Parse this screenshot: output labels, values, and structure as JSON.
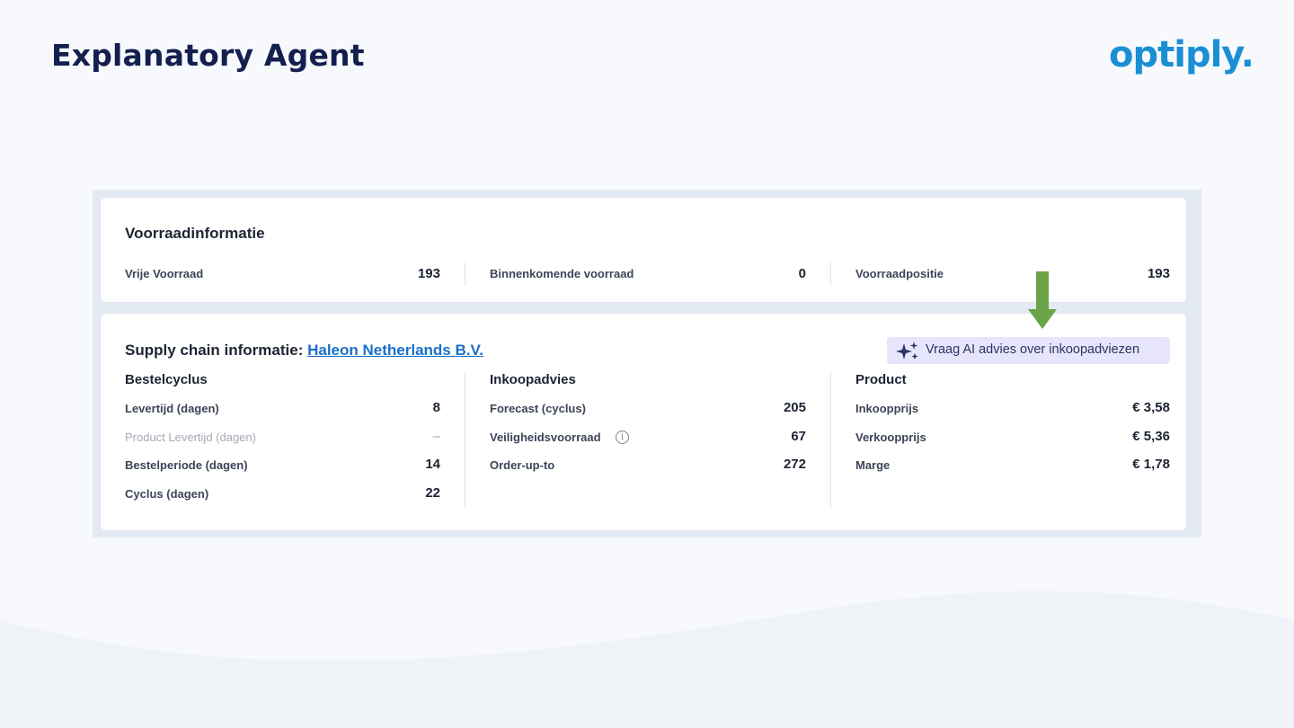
{
  "slide": {
    "title": "Explanatory Agent",
    "logo": "optiply."
  },
  "stock": {
    "title": "Voorraadinformatie",
    "items": [
      {
        "label": "Vrije Voorraad",
        "value": "193"
      },
      {
        "label": "Binnenkomende voorraad",
        "value": "0"
      },
      {
        "label": "Voorraadpositie",
        "value": "193"
      }
    ]
  },
  "supply": {
    "title": "Supply chain informatie:",
    "supplier": "Haleon Netherlands B.V.",
    "ai_button": "Vraag AI advies over inkoopadviezen",
    "columns": [
      {
        "title": "Bestelcyclus",
        "rows": [
          {
            "label": "Levertijd (dagen)",
            "value": "8"
          },
          {
            "label": "Product Levertijd (dagen)",
            "value": "–"
          },
          {
            "label": "Bestelperiode (dagen)",
            "value": "14"
          },
          {
            "label": "Cyclus (dagen)",
            "value": "22"
          }
        ]
      },
      {
        "title": "Inkoopadvies",
        "rows": [
          {
            "label": "Forecast (cyclus)",
            "value": "205"
          },
          {
            "label": "Veiligheidsvoorraad",
            "value": "67"
          },
          {
            "label": "Order-up-to",
            "value": "272"
          }
        ]
      },
      {
        "title": "Product",
        "rows": [
          {
            "label": "Inkoopprijs",
            "value": "€ 3,58"
          },
          {
            "label": "Verkoopprijs",
            "value": "€ 5,36"
          },
          {
            "label": "Marge",
            "value": "€ 1,78"
          }
        ]
      }
    ]
  },
  "colors": {
    "title": "#13204f",
    "logo": "#1a8fd6",
    "link": "#1a6fc8",
    "ai_button_bg": "#e6e5fb",
    "arrow": "#6ba348"
  },
  "icons": {
    "ai": "sparkles-icon",
    "info": "info-icon",
    "arrow": "arrow-down-icon"
  }
}
